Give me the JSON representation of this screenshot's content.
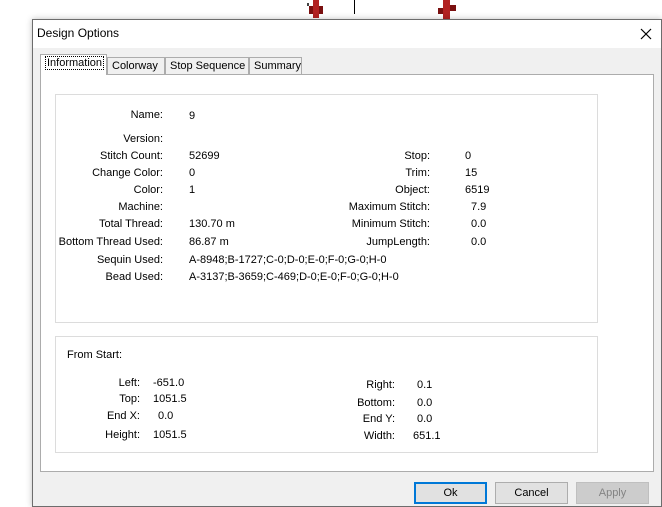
{
  "window": {
    "title": "Design Options"
  },
  "tabs": [
    {
      "label": "Information"
    },
    {
      "label": "Colorway"
    },
    {
      "label": "Stop Sequence"
    },
    {
      "label": "Summary"
    }
  ],
  "info": {
    "name": {
      "label": "Name:",
      "value": "9"
    },
    "version": {
      "label": "Version:",
      "value": ""
    },
    "stitch_count": {
      "label": "Stitch Count:",
      "value": "52699"
    },
    "change_color": {
      "label": "Change Color:",
      "value": "0"
    },
    "color": {
      "label": "Color:",
      "value": "1"
    },
    "machine": {
      "label": "Machine:",
      "value": ""
    },
    "total_thread": {
      "label": "Total Thread:",
      "value": "130.70 m"
    },
    "bottom_thread": {
      "label": "Bottom Thread Used:",
      "value": "86.87 m"
    },
    "sequin_used": {
      "label": "Sequin Used:",
      "value": "A-8948;B-1727;C-0;D-0;E-0;F-0;G-0;H-0"
    },
    "bead_used": {
      "label": "Bead Used:",
      "value": "A-3137;B-3659;C-469;D-0;E-0;F-0;G-0;H-0"
    },
    "stop": {
      "label": "Stop:",
      "value": "0"
    },
    "trim": {
      "label": "Trim:",
      "value": "15"
    },
    "object": {
      "label": "Object:",
      "value": "6519"
    },
    "max_stitch": {
      "label": "Maximum Stitch:",
      "value": "7.9"
    },
    "min_stitch": {
      "label": "Minimum Stitch:",
      "value": "0.0"
    },
    "jump_length": {
      "label": "JumpLength:",
      "value": "0.0"
    }
  },
  "from_start": {
    "heading": "From Start:",
    "left": {
      "label": "Left:",
      "value": "-651.0"
    },
    "top": {
      "label": "Top:",
      "value": "1051.5"
    },
    "end_x": {
      "label": "End X:",
      "value": "0.0"
    },
    "height": {
      "label": "Height:",
      "value": "1051.5"
    },
    "right": {
      "label": "Right:",
      "value": "0.1"
    },
    "bottom": {
      "label": "Bottom:",
      "value": "0.0"
    },
    "end_y": {
      "label": "End Y:",
      "value": "0.0"
    },
    "width": {
      "label": "Width:",
      "value": "651.1"
    }
  },
  "buttons": {
    "ok": "Ok",
    "cancel": "Cancel",
    "apply": "Apply"
  },
  "colors": {
    "accent": "#0078d7",
    "deco_red": "#c0392b"
  }
}
